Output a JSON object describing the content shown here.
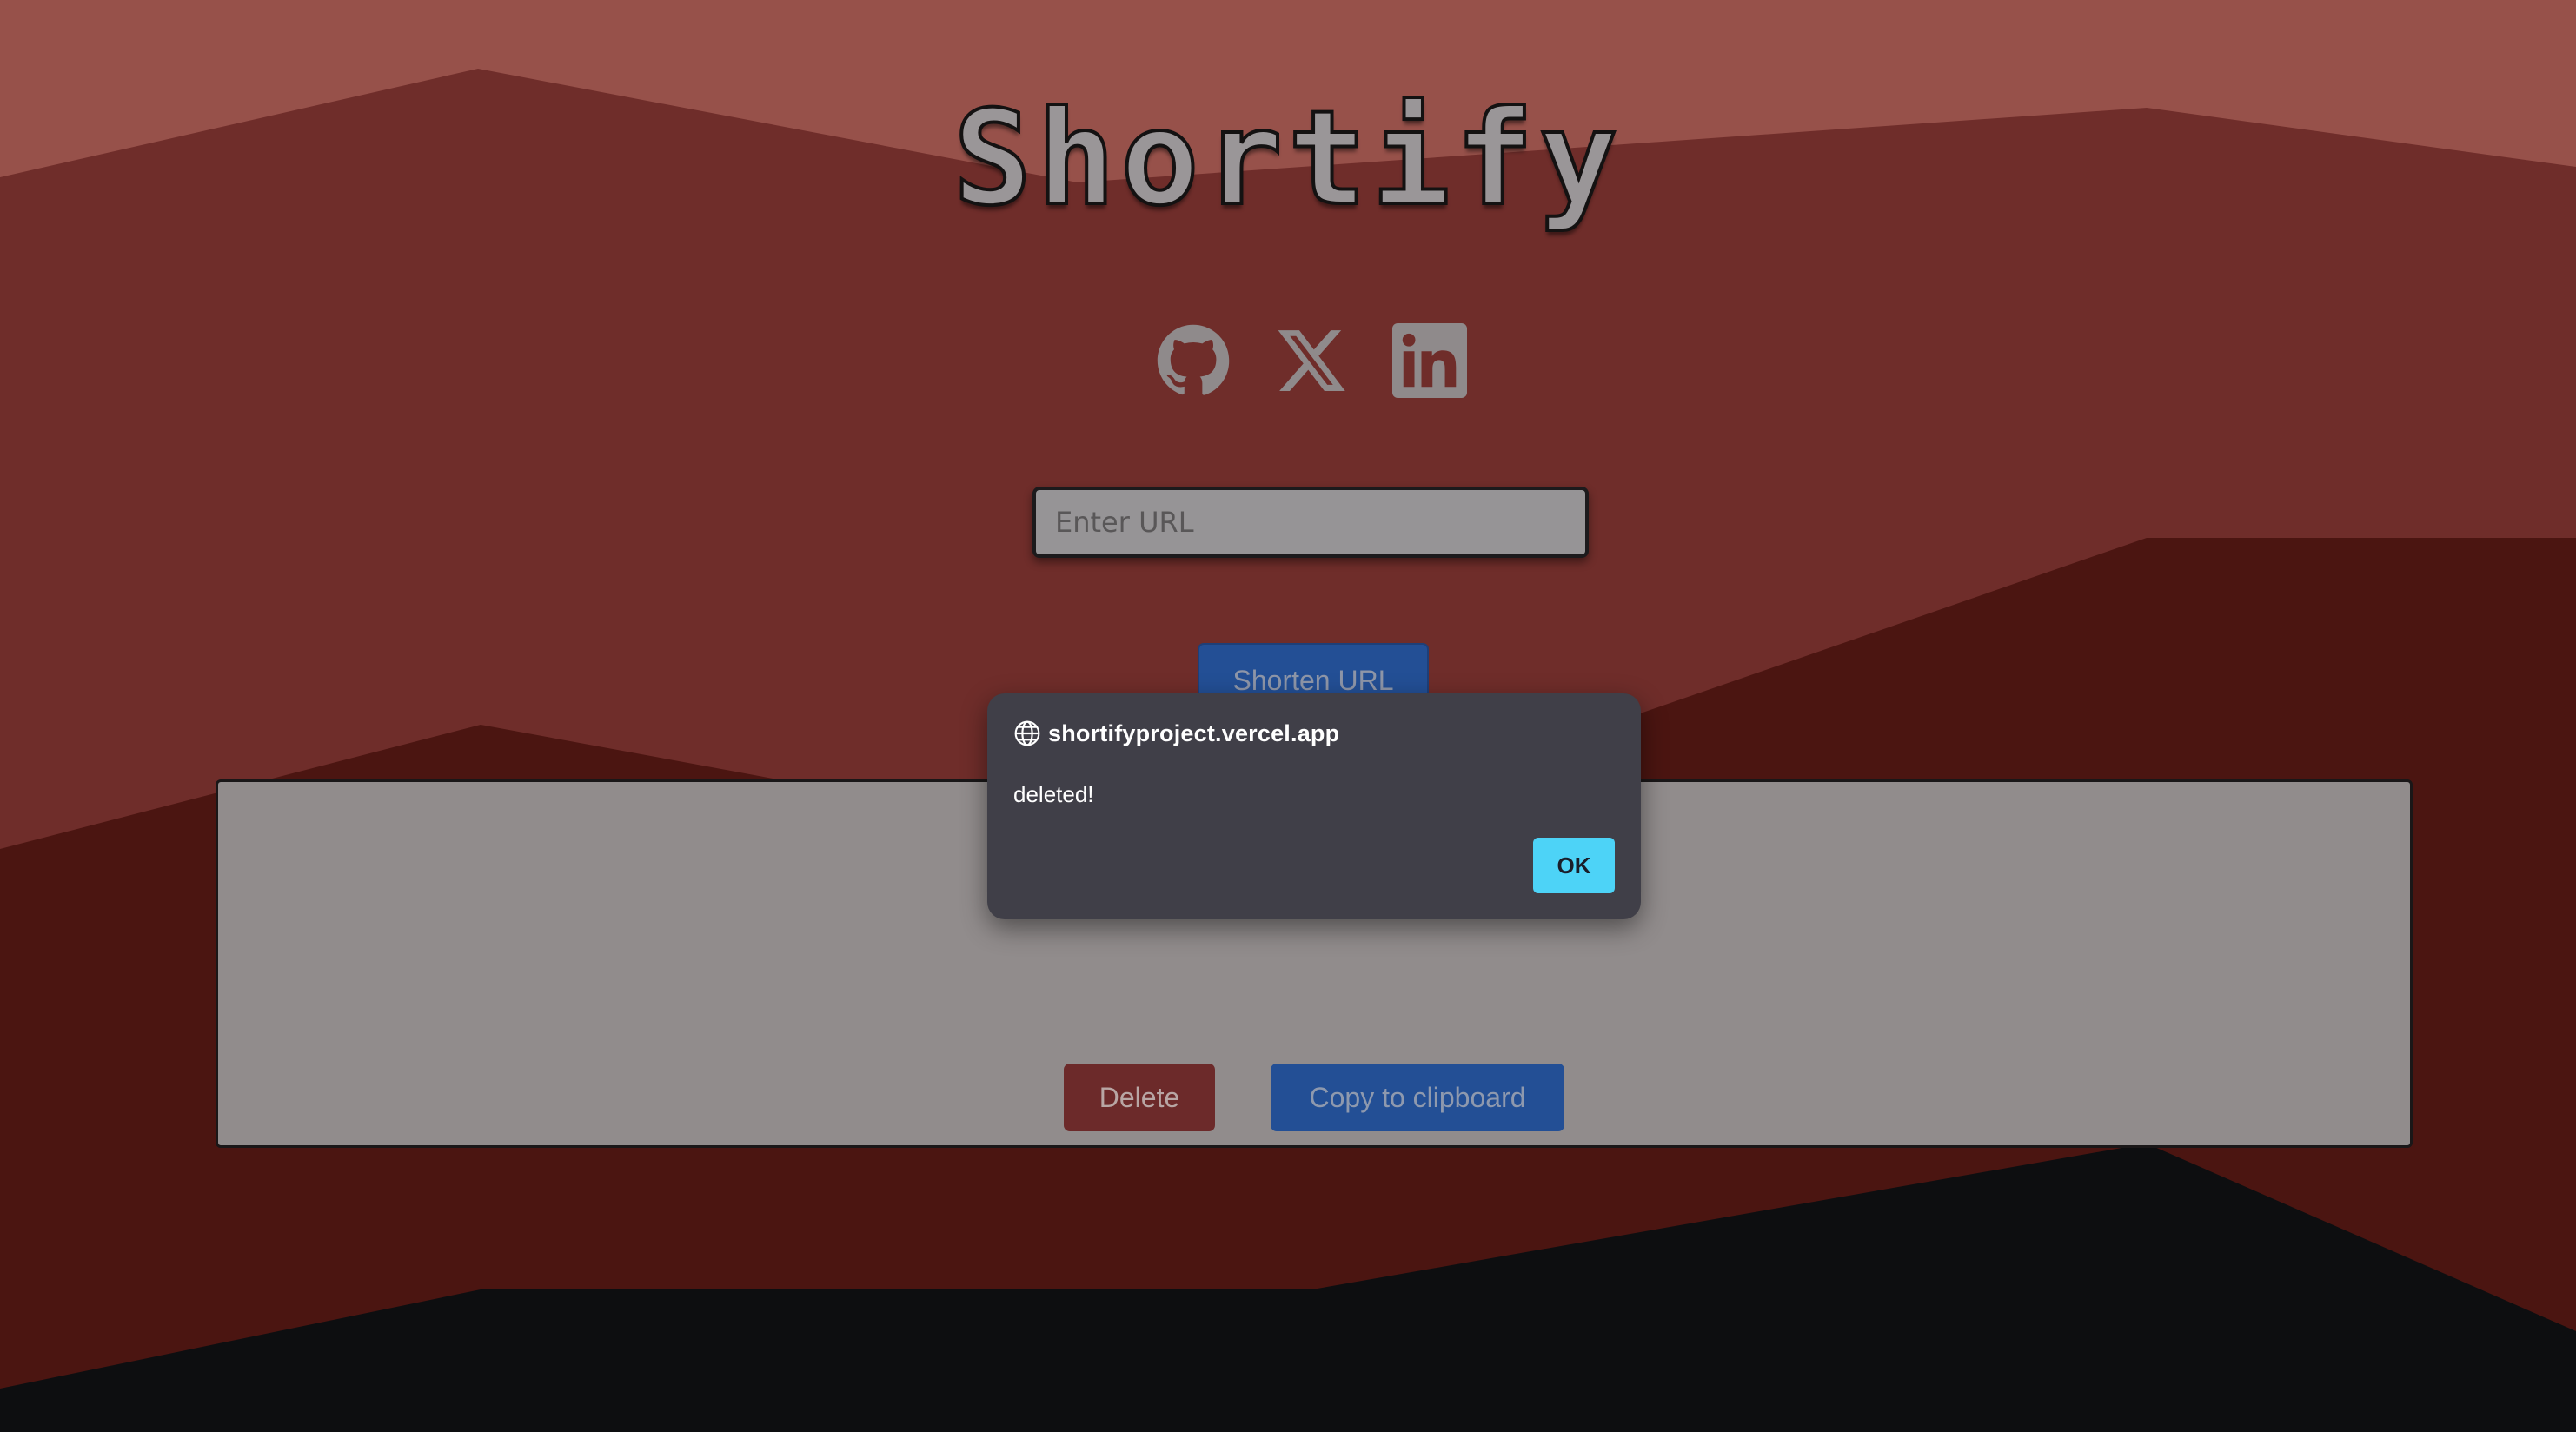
{
  "page": {
    "title": "Shortify",
    "colors": {
      "sky": "#97514a",
      "mountain_near": "#6f2d2a",
      "mountain_far": "#4b1511",
      "ground": "#0d0e10",
      "card_bg": "#918c8c",
      "primary_button": "#234f95",
      "danger_button": "#6c2a2a",
      "dialog_bg": "#403f48",
      "dialog_ok": "#4dd3f7"
    }
  },
  "socials": {
    "items": [
      {
        "name": "GitHub",
        "icon": "github-icon"
      },
      {
        "name": "X",
        "icon": "x-icon"
      },
      {
        "name": "LinkedIn",
        "icon": "linkedin-icon"
      }
    ]
  },
  "form": {
    "url_placeholder": "Enter URL",
    "url_value": "",
    "shorten_label": "Shorten URL"
  },
  "result": {
    "delete_label": "Delete",
    "copy_label": "Copy to clipboard"
  },
  "dialog": {
    "origin": "shortifyproject.vercel.app",
    "origin_icon": "globe-icon",
    "message": "deleted!",
    "ok_label": "OK"
  }
}
